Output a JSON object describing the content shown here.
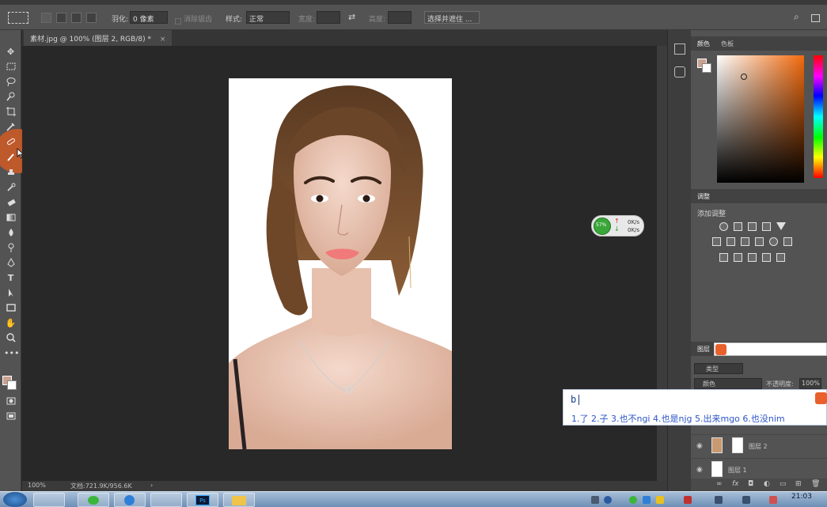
{
  "options_bar": {
    "feather_label": "羽化:",
    "feather_value": "0 像素",
    "antialias_label": "消除锯齿",
    "style_label": "样式:",
    "style_value": "正常",
    "width_label": "宽度:",
    "height_label": "高度:",
    "select_mask_button": "选择并遮住 ..."
  },
  "document": {
    "tab_title": "素材.jpg @ 100% (图层 2, RGB/8) *",
    "zoom": "100%",
    "doc_size": "文档:721.9K/956.6K"
  },
  "panels": {
    "color_tab": "颜色",
    "swatches_tab": "色板",
    "adjustments_tab": "调整",
    "add_adjustment": "添加调整",
    "layers_tab": "图层",
    "kind_filter": "类型",
    "blend_mode": "颜色",
    "opacity_label": "不透明度:",
    "opacity_value": "100%",
    "layers": [
      {
        "name": "图层 2"
      },
      {
        "name": "图层 1"
      }
    ]
  },
  "network_widget": {
    "percent": "57%",
    "up": "0K/s",
    "down": "0K/s"
  },
  "ime": {
    "input": "b",
    "candidates": "1.了  2.子  3.也不ngi  4.也是njg  5.出来mgo  6.也没nim"
  },
  "taskbar": {
    "time": "21:03"
  },
  "colors": {
    "foreground": "#c9a290",
    "background": "#ffffff",
    "accent_tool_highlight": "#c85a28"
  }
}
